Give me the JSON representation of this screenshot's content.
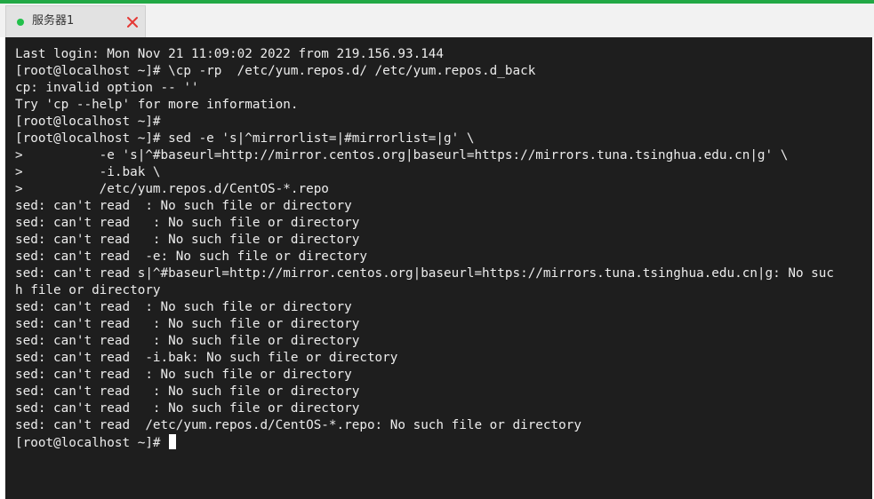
{
  "tab": {
    "label": "服务器1",
    "status_color": "#22c04b",
    "close_color": "#e53935",
    "status_icon": "status-dot",
    "close_icon": "close-x"
  },
  "colors": {
    "accent": "#22a845",
    "terminal_bg": "#1e1e1e",
    "terminal_fg": "#ececec"
  },
  "terminal": {
    "lines": [
      "Last login: Mon Nov 21 11:09:02 2022 from 219.156.93.144",
      "[root@localhost ~]# \\cp -rp  /etc/yum.repos.d/ /etc/yum.repos.d_back",
      "cp: invalid option -- ''",
      "Try 'cp --help' for more information.",
      "[root@localhost ~]#",
      "[root@localhost ~]# sed -e 's|^mirrorlist=|#mirrorlist=|g' \\",
      ">          -e 's|^#baseurl=http://mirror.centos.org|baseurl=https://mirrors.tuna.tsinghua.edu.cn|g' \\",
      ">          -i.bak \\",
      ">          /etc/yum.repos.d/CentOS-*.repo",
      "sed: can't read  : No such file or directory",
      "sed: can't read   : No such file or directory",
      "sed: can't read   : No such file or directory",
      "sed: can't read  -e: No such file or directory",
      "sed: can't read s|^#baseurl=http://mirror.centos.org|baseurl=https://mirrors.tuna.tsinghua.edu.cn|g: No suc",
      "h file or directory",
      "sed: can't read  : No such file or directory",
      "sed: can't read   : No such file or directory",
      "sed: can't read   : No such file or directory",
      "sed: can't read  -i.bak: No such file or directory",
      "sed: can't read  : No such file or directory",
      "sed: can't read   : No such file or directory",
      "sed: can't read   : No such file or directory",
      "sed: can't read  /etc/yum.repos.d/CentOS-*.repo: No such file or directory"
    ],
    "prompt": "[root@localhost ~]# "
  }
}
